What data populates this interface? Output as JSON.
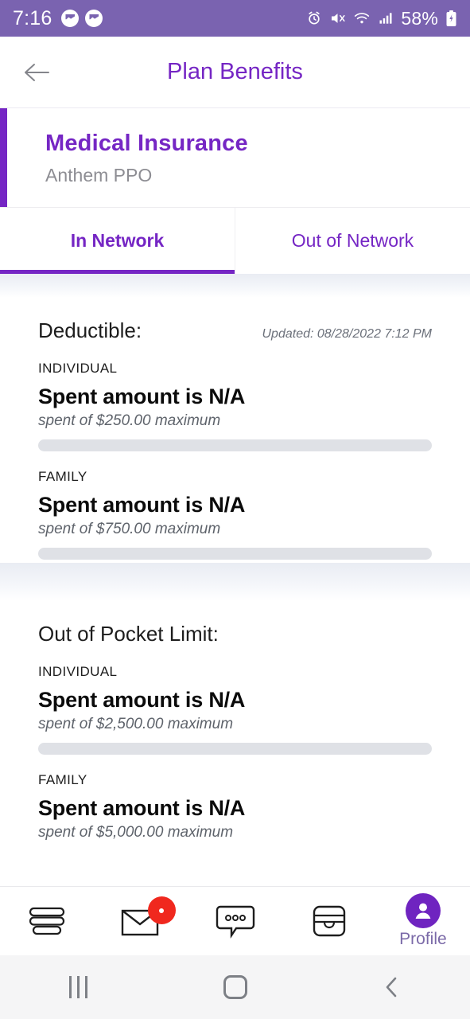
{
  "status_bar": {
    "time": "7:16",
    "battery_percent": "58%",
    "icons": [
      "messenger-icon",
      "messenger-icon",
      "alarm-icon",
      "mute-icon",
      "wifi-icon",
      "cellular-signal-icon",
      "battery-charging-icon"
    ]
  },
  "header": {
    "title": "Plan Benefits",
    "back_icon": "back-arrow-icon"
  },
  "plan_card": {
    "title": "Medical Insurance",
    "subtitle": "Anthem PPO",
    "accent_color": "#7526c4"
  },
  "tabs": [
    {
      "label": "In Network",
      "active": true
    },
    {
      "label": "Out of Network",
      "active": false
    }
  ],
  "sections": [
    {
      "title": "Deductible:",
      "updated": "Updated: 08/28/2022 7:12 PM",
      "rows": [
        {
          "label": "INDIVIDUAL",
          "value": "Spent amount is N/A",
          "sub": "spent of $250.00 maximum",
          "progress": 0
        },
        {
          "label": "FAMILY",
          "value": "Spent amount is N/A",
          "sub": "spent of $750.00 maximum",
          "progress": 0
        }
      ]
    },
    {
      "title": "Out of Pocket Limit:",
      "updated": "",
      "rows": [
        {
          "label": "INDIVIDUAL",
          "value": "Spent amount is N/A",
          "sub": "spent of $2,500.00 maximum",
          "progress": 0
        },
        {
          "label": "FAMILY",
          "value": "Spent amount is N/A",
          "sub": "spent of $5,000.00 maximum",
          "progress": 0
        }
      ]
    }
  ],
  "bottom_nav": [
    {
      "icon": "menu-stack-icon",
      "label": ""
    },
    {
      "icon": "envelope-icon",
      "label": "",
      "badge": true
    },
    {
      "icon": "chat-bubble-icon",
      "label": ""
    },
    {
      "icon": "wallet-card-icon",
      "label": ""
    },
    {
      "icon": "profile-avatar-icon",
      "label": "Profile"
    }
  ],
  "android_nav": {
    "recents": "recents-icon",
    "home": "home-icon",
    "back": "back-icon"
  },
  "colors": {
    "brand_purple": "#7526c4",
    "status_bar": "#7a63b0",
    "badge_red": "#f0281e",
    "track_gray": "#dfe1e6"
  }
}
